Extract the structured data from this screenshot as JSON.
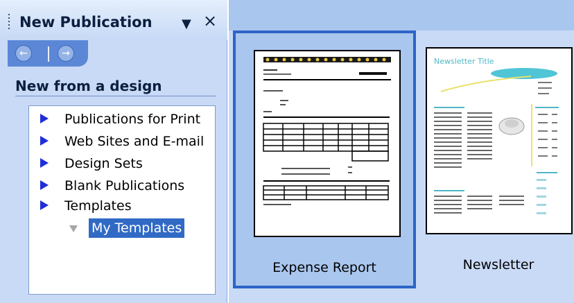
{
  "pane": {
    "title": "New Publication",
    "dropdown_icon": "▼",
    "close_icon": "×",
    "back_icon": "←",
    "forward_icon": "→",
    "section_title": "New from a design",
    "tree": [
      {
        "label": "Publications for Print"
      },
      {
        "label": "Web Sites and E-mail"
      },
      {
        "label": "Design Sets"
      },
      {
        "label": "Blank Publications"
      },
      {
        "label": "Templates"
      }
    ],
    "selected_item": "My Templates"
  },
  "gallery": {
    "tiles": [
      {
        "label": "Expense Report",
        "selected": true
      },
      {
        "label": "Newsletter",
        "thumbnail_heading": "Newsletter Title",
        "selected": false
      }
    ]
  },
  "colors": {
    "selection": "#316ac5",
    "tile_border": "#2d64c8",
    "arrow": "#1f2fd8"
  }
}
